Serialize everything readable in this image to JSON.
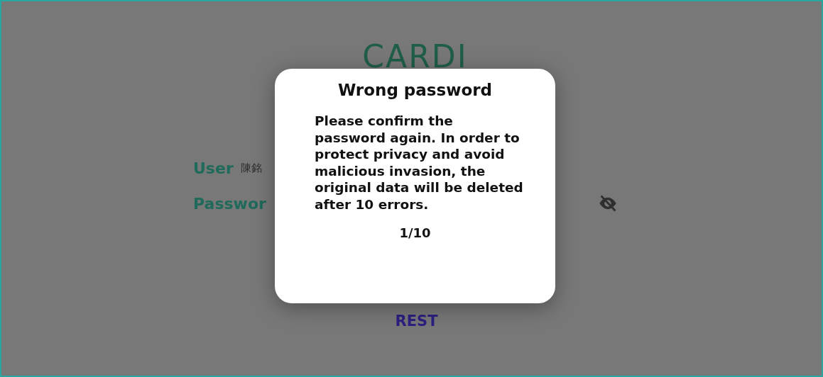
{
  "logo": {
    "text": "CARDI"
  },
  "login": {
    "user_label": "User",
    "user_value": "陳銘",
    "password_label": "Passwor",
    "password_visible": false,
    "reset_button": "REST"
  },
  "dialog": {
    "title": "Wrong password",
    "message": "Please confirm the password again. In order to protect privacy and avoid malicious invasion, the original data will be deleted after 10 errors.",
    "count": "1/10"
  }
}
